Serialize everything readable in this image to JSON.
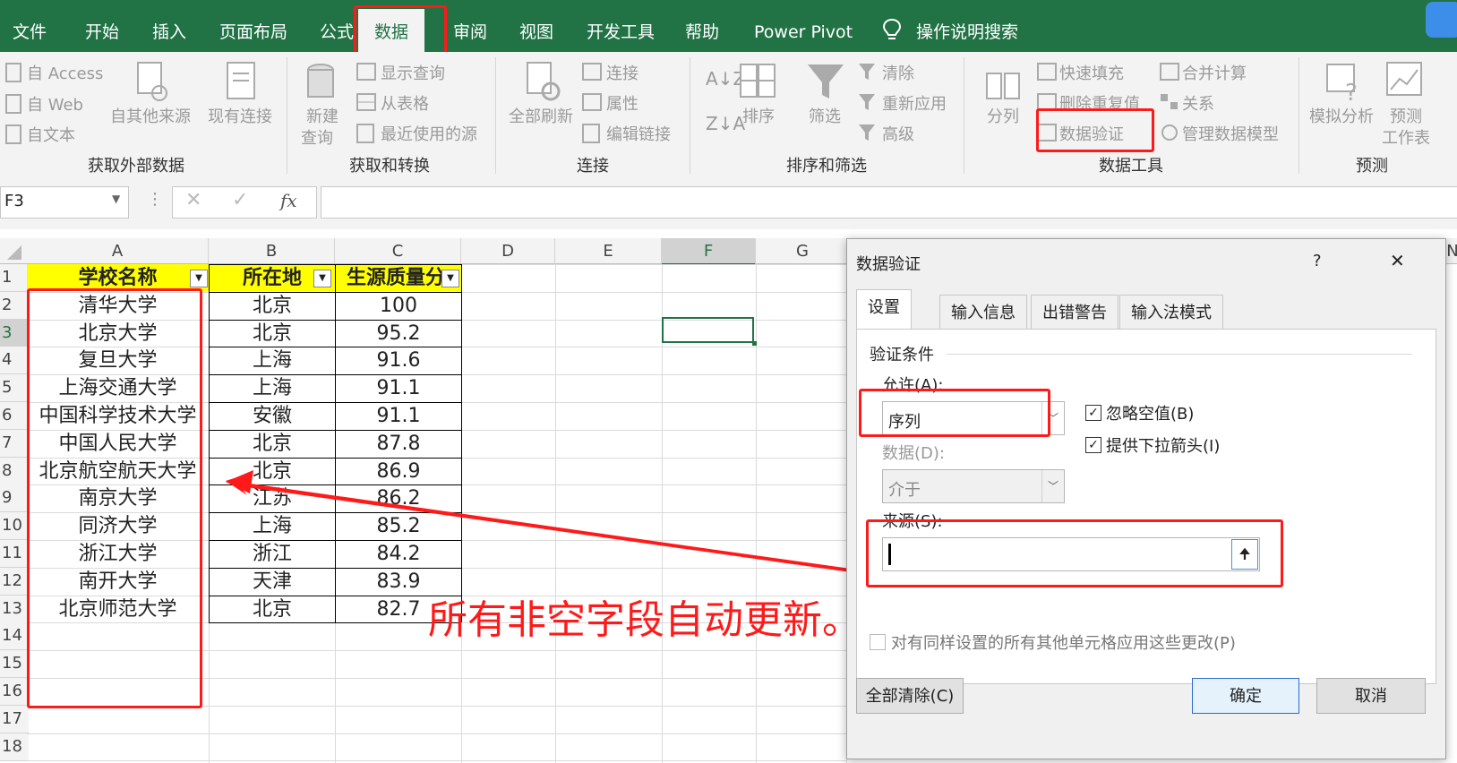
{
  "ribbon_tabs": [
    "文件",
    "开始",
    "插入",
    "页面布局",
    "公式",
    "数据",
    "审阅",
    "视图",
    "开发工具",
    "帮助",
    "Power Pivot",
    "操作说明搜索"
  ],
  "active_tab": "数据",
  "ribbon": {
    "get_external": {
      "access": "自 Access",
      "web": "自 Web",
      "text": "自文本",
      "other_src": "自其他来源",
      "existing": "现有连接",
      "group": "获取外部数据"
    },
    "get_transform": {
      "new_query_1": "新建",
      "new_query_2": "查询",
      "show_query": "显示查询",
      "from_table": "从表格",
      "recent_src": "最近使用的源",
      "group": "获取和转换"
    },
    "connections": {
      "refresh_all": "全部刷新",
      "connections": "连接",
      "properties": "属性",
      "edit_links": "编辑链接",
      "group": "连接"
    },
    "sort_filter": {
      "sort": "排序",
      "filter": "筛选",
      "clear": "清除",
      "reapply": "重新应用",
      "advanced": "高级",
      "group": "排序和筛选"
    },
    "data_tools": {
      "split": "分列",
      "flash_fill": "快速填充",
      "remove_dup": "删除重复值",
      "validation": "数据验证",
      "consolidate": "合并计算",
      "relations": "关系",
      "data_model": "管理数据模型",
      "group": "数据工具"
    },
    "forecast": {
      "what_if": "模拟分析",
      "forecast_1": "预测",
      "forecast_2": "工作表",
      "group": "预测"
    }
  },
  "formula_bar": {
    "name_box": "F3",
    "fx": "fx",
    "formula": ""
  },
  "columns": [
    "A",
    "B",
    "C",
    "D",
    "E",
    "F",
    "G",
    "N"
  ],
  "rows": [
    "1",
    "2",
    "3",
    "4",
    "5",
    "6",
    "7",
    "8",
    "9",
    "10",
    "11",
    "12",
    "13",
    "14",
    "15",
    "16",
    "17",
    "18"
  ],
  "table_headers": [
    "学校名称",
    "所在地",
    "生源质量分"
  ],
  "table_rows": [
    [
      "清华大学",
      "北京",
      "100"
    ],
    [
      "北京大学",
      "北京",
      "95.2"
    ],
    [
      "复旦大学",
      "上海",
      "91.6"
    ],
    [
      "上海交通大学",
      "上海",
      "91.1"
    ],
    [
      "中国科学技术大学",
      "安徽",
      "91.1"
    ],
    [
      "中国人民大学",
      "北京",
      "87.8"
    ],
    [
      "北京航空航天大学",
      "北京",
      "86.9"
    ],
    [
      "南京大学",
      "江苏",
      "86.2"
    ],
    [
      "同济大学",
      "上海",
      "85.2"
    ],
    [
      "浙江大学",
      "浙江",
      "84.2"
    ],
    [
      "南开大学",
      "天津",
      "83.9"
    ],
    [
      "北京师范大学",
      "北京",
      "82.7"
    ]
  ],
  "annotation_text": "所有非空字段自动更新。",
  "dialog": {
    "title": "数据验证",
    "help": "?",
    "close": "✕",
    "tabs": [
      "设置",
      "输入信息",
      "出错警告",
      "输入法模式"
    ],
    "section": "验证条件",
    "allow_label": "允许(A):",
    "allow_value": "序列",
    "data_label": "数据(D):",
    "data_value": "介于",
    "ignore_blank": "忽略空值(B)",
    "dropdown_arrow": "提供下拉箭头(I)",
    "source_label": "来源(S):",
    "source_value": "",
    "apply_all": "对有同样设置的所有其他单元格应用这些更改(P)",
    "clear_all": "全部清除(C)",
    "ok": "确定",
    "cancel": "取消"
  },
  "colors": {
    "excel_green": "#217346",
    "highlight_red": "#ff1a1a",
    "header_yellow": "#ffff00"
  }
}
